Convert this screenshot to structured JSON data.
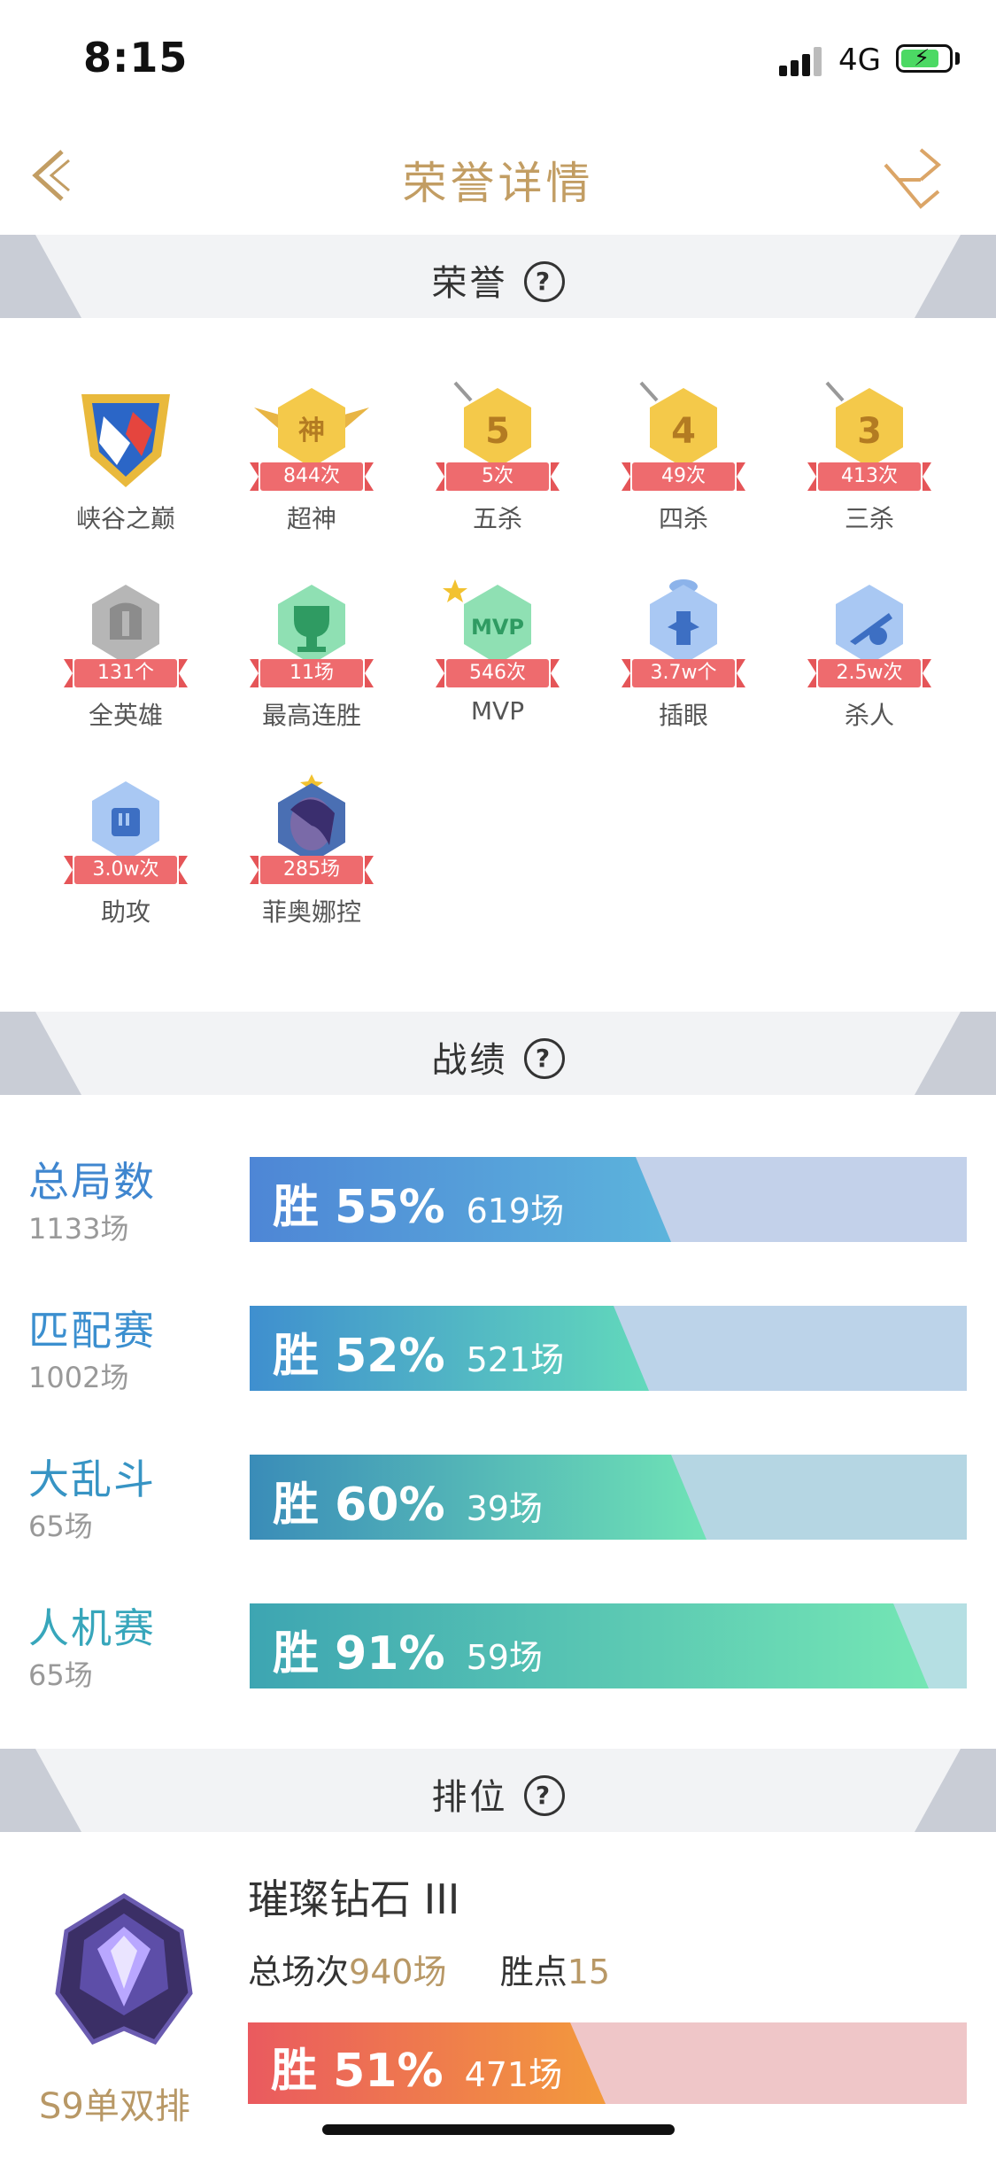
{
  "status_bar": {
    "time": "8:15",
    "network": "4G"
  },
  "nav": {
    "title": "荣誉详情"
  },
  "sections": {
    "honor": "荣誉",
    "record": "战绩",
    "rank": "排位"
  },
  "honors": [
    {
      "name": "峡谷之巅",
      "badge": "",
      "icon": "peak-shield-icon"
    },
    {
      "name": "超神",
      "badge": "844次",
      "icon": "legendary-medal-icon"
    },
    {
      "name": "五杀",
      "badge": "5次",
      "icon": "penta-kill-icon"
    },
    {
      "name": "四杀",
      "badge": "49次",
      "icon": "quadra-kill-icon"
    },
    {
      "name": "三杀",
      "badge": "413次",
      "icon": "triple-kill-icon"
    },
    {
      "name": "全英雄",
      "badge": "131个",
      "icon": "all-heroes-icon"
    },
    {
      "name": "最高连胜",
      "badge": "11场",
      "icon": "trophy-icon"
    },
    {
      "name": "MVP",
      "badge": "546次",
      "icon": "mvp-icon"
    },
    {
      "name": "插眼",
      "badge": "3.7w个",
      "icon": "ward-icon"
    },
    {
      "name": "杀人",
      "badge": "2.5w次",
      "icon": "kill-icon"
    },
    {
      "name": "助攻",
      "badge": "3.0w次",
      "icon": "assist-icon"
    },
    {
      "name": "菲奥娜控",
      "badge": "285场",
      "icon": "fiora-portrait-icon"
    }
  ],
  "stats": [
    {
      "label": "总局数",
      "count": "1133场",
      "win_label": "胜 55%",
      "games": "619场",
      "win_rate": 0.55,
      "colors": [
        "#4e86d6",
        "#5cb4dc"
      ],
      "bg": "#c3d1ea",
      "label_color": "#3f86cf"
    },
    {
      "label": "匹配赛",
      "count": "1002场",
      "win_label": "胜 52%",
      "games": "521场",
      "win_rate": 0.52,
      "colors": [
        "#3f8fcf",
        "#62d9bb"
      ],
      "bg": "#bcd3e9",
      "label_color": "#3b8fcf"
    },
    {
      "label": "大乱斗",
      "count": "65场",
      "win_label": "胜 60%",
      "games": "39场",
      "win_rate": 0.6,
      "colors": [
        "#3a8cb8",
        "#6fe3b6"
      ],
      "bg": "#b5d6e3",
      "label_color": "#3794c4"
    },
    {
      "label": "人机赛",
      "count": "65场",
      "win_label": "胜 91%",
      "games": "59场",
      "win_rate": 0.91,
      "colors": [
        "#3da5b2",
        "#74e6b4"
      ],
      "bg": "#b5dfe3",
      "label_color": "#37a6bb"
    }
  ],
  "rank": {
    "tier": "璀璨钻石 III",
    "total_label": "总场次",
    "total_value": "940场",
    "points_label": "胜点",
    "points_value": "15",
    "win_label": "胜 51%",
    "games": "471场",
    "win_rate": 0.51,
    "season": "S9单双排",
    "colors": [
      "#ea5a5f",
      "#f39a3c"
    ],
    "bg": "#efc6c8"
  }
}
